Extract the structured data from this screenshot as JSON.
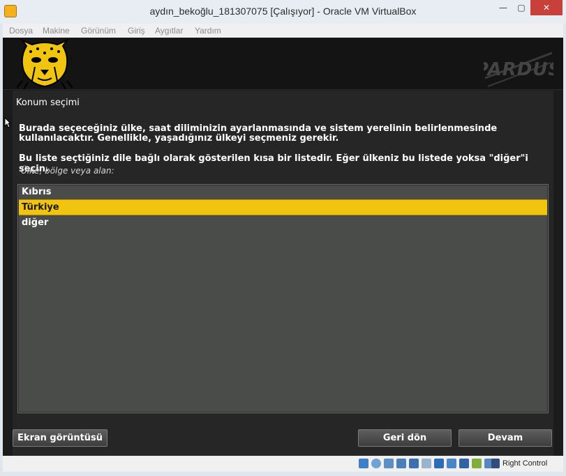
{
  "window": {
    "title": "aydın_bekoğlu_181307075 [Çalışıyor] - Oracle VM VirtualBox",
    "minimize_glyph": "—",
    "maximize_glyph": "▢",
    "close_glyph": "✕"
  },
  "menu": [
    "Dosya",
    "Makine",
    "Görünüm",
    "Giriş",
    "Aygıtlar",
    "Yardım"
  ],
  "installer": {
    "brand": "PARDUS",
    "section_title": "Konum seçimi",
    "description": "Burada seçeceğiniz ülke, saat diliminizin ayarlanmasında ve sistem yerelinin belirlenmesinde kullanılacaktır. Genellikle, yaşadığınız ülkeyi seçmeniz gerekir.",
    "description2": "Bu liste seçtiğiniz dile bağlı olarak gösterilen kısa bir listedir. Eğer ülkeniz bu listede yoksa \"diğer\"i seçin.",
    "field_label": "Ülke, bölge veya alan:",
    "countries": [
      "Kıbrıs",
      "Türkiye",
      "diğer"
    ],
    "selected_country": "Türkiye",
    "buttons": {
      "screenshot": "Ekran görüntüsü",
      "back": "Geri dön",
      "continue": "Devam"
    },
    "accent_color": "#f1c40f"
  },
  "statusbar": {
    "host_key": "Right Control",
    "icons": [
      "hard-disk-icon",
      "optical-drive-icon",
      "audio-icon",
      "network-icon",
      "usb-icon",
      "shared-folders-icon",
      "display-icon",
      "video-capture-icon",
      "recording-icon",
      "cpu-icon",
      "mouse-integration-icon",
      "keyboard-capture-icon"
    ]
  }
}
